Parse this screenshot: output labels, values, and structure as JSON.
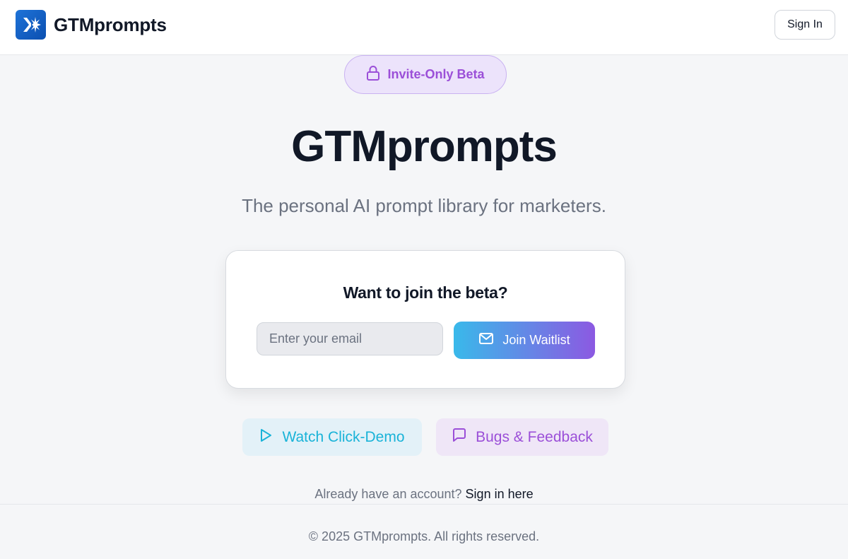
{
  "header": {
    "brand": "GTMprompts",
    "sign_in_label": "Sign In"
  },
  "badge": {
    "label": "Invite-Only Beta"
  },
  "hero": {
    "title": "GTMprompts",
    "tagline": "The personal AI prompt library for marketers."
  },
  "waitlist_card": {
    "title": "Want to join the beta?",
    "email_placeholder": "Enter your email",
    "email_value": "",
    "button_label": "Join Waitlist"
  },
  "actions": {
    "demo_label": "Watch Click-Demo",
    "feedback_label": "Bugs & Feedback"
  },
  "signin_prompt": {
    "text": "Already have an account?",
    "link": "Sign in here"
  },
  "footer": {
    "copyright": "© 2025 GTMprompts. All rights reserved."
  },
  "icons": {
    "logo": "spark-logo-icon",
    "badge": "lock-icon",
    "join": "mail-icon",
    "demo": "play-icon",
    "feedback": "message-square-icon"
  },
  "colors": {
    "brand_blue": "#1e73d8",
    "accent_purple": "#9b4fd8",
    "accent_cyan": "#1ab3d8",
    "gradient_start": "#39b9ea",
    "gradient_end": "#8c59e2"
  }
}
